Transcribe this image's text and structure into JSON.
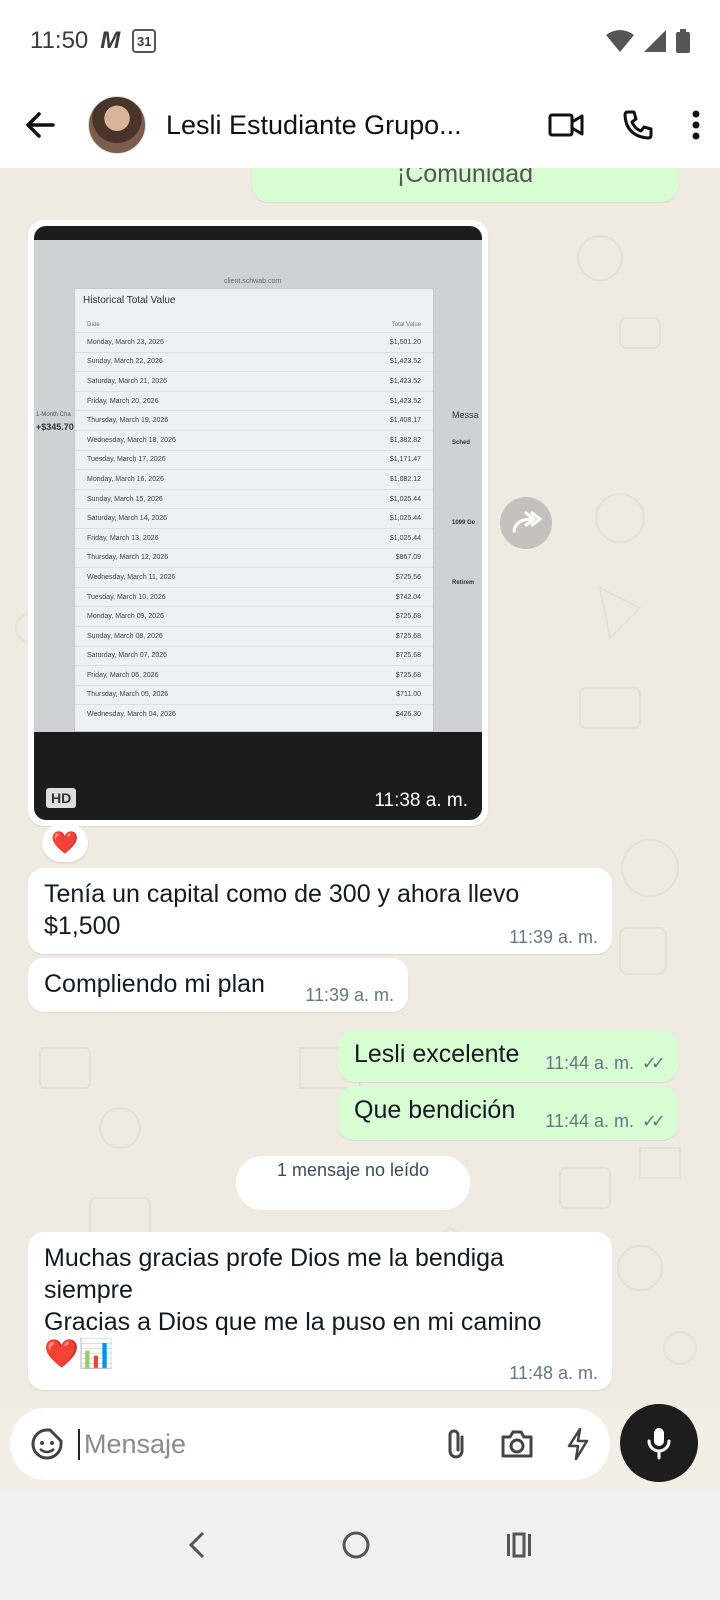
{
  "status_bar": {
    "time": "11:50",
    "calendar_day": "31",
    "carrier_logo": "M"
  },
  "header": {
    "contact_name": "Lesli Estudiante Grupo..."
  },
  "chat": {
    "prev_message_fragment": "¡Comunidad",
    "image_message": {
      "time": "11:38 a. m.",
      "hd_label": "HD",
      "reaction": "❤️",
      "screenshot": {
        "url": "client.schwab.com",
        "title": "Historical Total Value",
        "col_date": "Date",
        "col_value": "Total Value",
        "side_label": "1-Month Cha",
        "side_value": "+$345.70",
        "right_labels": [
          "Messa",
          "Sched",
          "1099 Ge",
          "Retirem"
        ],
        "rows": [
          {
            "date": "Monday, March 23, 2026",
            "value": "$1,501.20"
          },
          {
            "date": "Sunday, March 22, 2026",
            "value": "$1,423.52"
          },
          {
            "date": "Saturday, March 21, 2026",
            "value": "$1,423.52"
          },
          {
            "date": "Friday, March 20, 2026",
            "value": "$1,423.52"
          },
          {
            "date": "Thursday, March 19, 2026",
            "value": "$1,408.17"
          },
          {
            "date": "Wednesday, March 18, 2026",
            "value": "$1,382.82"
          },
          {
            "date": "Tuesday, March 17, 2026",
            "value": "$1,171.47"
          },
          {
            "date": "Monday, March 16, 2026",
            "value": "$1,082.12"
          },
          {
            "date": "Sunday, March 15, 2026",
            "value": "$1,025.44"
          },
          {
            "date": "Saturday, March 14, 2026",
            "value": "$1,025.44"
          },
          {
            "date": "Friday, March 13, 2026",
            "value": "$1,025.44"
          },
          {
            "date": "Thursday, March 12, 2026",
            "value": "$867.09"
          },
          {
            "date": "Wednesday, March 11, 2026",
            "value": "$725.56"
          },
          {
            "date": "Tuesday, March 10, 2026",
            "value": "$742.04"
          },
          {
            "date": "Monday, March 09, 2026",
            "value": "$725.68"
          },
          {
            "date": "Sunday, March 08, 2026",
            "value": "$725.68"
          },
          {
            "date": "Saturday, March 07, 2026",
            "value": "$725.68"
          },
          {
            "date": "Friday, March 06, 2026",
            "value": "$725.68"
          },
          {
            "date": "Thursday, March 05, 2026",
            "value": "$711.00"
          },
          {
            "date": "Wednesday, March 04, 2026",
            "value": "$426.30"
          }
        ]
      }
    },
    "messages": [
      {
        "id": "m1",
        "dir": "in",
        "text": "Tenía un capital como de 300 y ahora llevo $1,500",
        "time": "11:39 a. m."
      },
      {
        "id": "m2",
        "dir": "in",
        "text": "Compliendo mi plan",
        "time": "11:39 a. m."
      },
      {
        "id": "m3",
        "dir": "out",
        "text": "Lesli excelente",
        "time": "11:44 a. m."
      },
      {
        "id": "m4",
        "dir": "out",
        "text": "Que bendición",
        "time": "11:44 a. m."
      },
      {
        "id": "m5",
        "dir": "in",
        "text_line1": "Muchas gracias profe Dios me la bendiga siempre",
        "text_line2": "Gracias a Dios que me la puso en mi camino",
        "emojis": "❤️📊",
        "time": "11:48 a. m."
      }
    ],
    "unread_divider": "1 mensaje no leído"
  },
  "input": {
    "placeholder": "Mensaje"
  },
  "colors": {
    "out_bubble": "#d9fdd3",
    "in_bubble": "#ffffff",
    "chat_bg": "#efeae2"
  }
}
